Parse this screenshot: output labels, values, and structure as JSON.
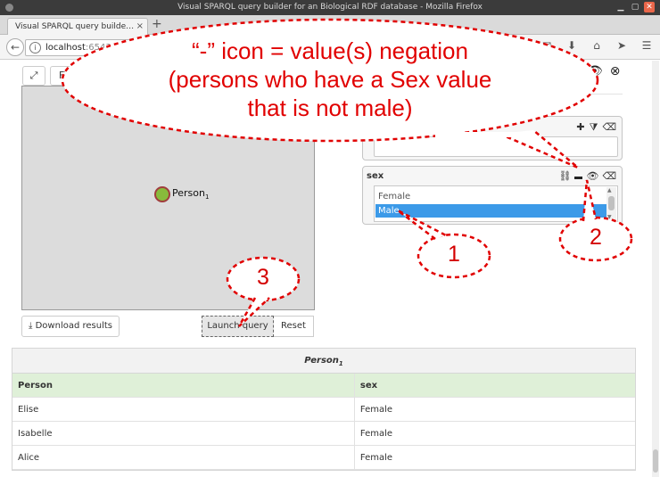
{
  "window": {
    "title": "Visual SPARQL query builder for an Biological RDF database - Mozilla Firefox",
    "tab_title": "Visual SPARQL query builde…",
    "tab_close": "×",
    "new_tab": "+"
  },
  "navbar": {
    "url_host": "localhost",
    "url_port": ":6543"
  },
  "toolbar": {
    "filter_label": "Fi"
  },
  "graph": {
    "node_label": "Person",
    "node_sub": "1"
  },
  "panels": {
    "sex_title": "sex",
    "options": [
      "Female",
      "Male"
    ],
    "selected": "Male"
  },
  "buttons": {
    "download": "Download results",
    "launch": "Launch query",
    "reset": "Reset"
  },
  "results": {
    "caption": "Person",
    "caption_sub": "1",
    "columns": [
      "Person",
      "sex"
    ],
    "rows": [
      [
        "Elise",
        "Female"
      ],
      [
        "Isabelle",
        "Female"
      ],
      [
        "Alice",
        "Female"
      ]
    ]
  },
  "annotations": {
    "callout_line1": "“-” icon = value(s) negation",
    "callout_line2": "(persons who have a Sex value",
    "callout_line3": "that is not male)",
    "step1": "1",
    "step2": "2",
    "step3": "3",
    "color": "#e10000"
  }
}
